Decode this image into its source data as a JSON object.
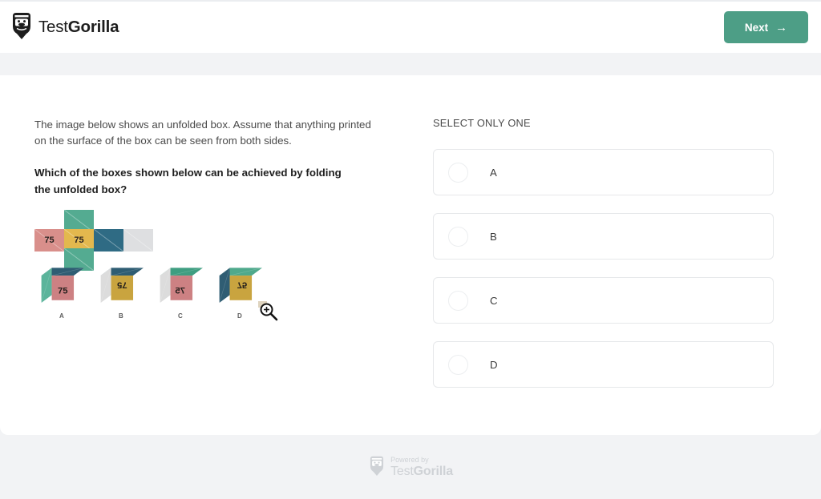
{
  "header": {
    "brand_name_light": "Test",
    "brand_name_bold": "Gorilla",
    "logo_icon": "gorilla-head-icon",
    "next_label": "Next",
    "next_arrow": "→",
    "next_color": "#4d9e86"
  },
  "question": {
    "intro": "The image below shows an unfolded box. Assume that anything printed on the surface of the box can be seen from both sides.",
    "prompt": "Which of the boxes shown below can be achieved by folding the unfolded box?"
  },
  "unfolded_net": {
    "description": "cross-shaped unfolded box net",
    "cells": [
      {
        "name": "top-flap",
        "col": 1,
        "row": 0,
        "fill": "#54ab91",
        "text": ""
      },
      {
        "name": "left-face",
        "col": 0,
        "row": 1,
        "fill": "#d98f8b",
        "text": "75"
      },
      {
        "name": "front-face",
        "col": 1,
        "row": 1,
        "fill": "#e3b84e",
        "text": "75"
      },
      {
        "name": "right-face",
        "col": 2,
        "row": 1,
        "fill": "#2f6b84",
        "text": ""
      },
      {
        "name": "far-face",
        "col": 3,
        "row": 1,
        "fill": "#dedfe1",
        "text": ""
      },
      {
        "name": "bottom-flap",
        "col": 1,
        "row": 2,
        "fill": "#54ab91",
        "text": ""
      }
    ]
  },
  "cubes": [
    {
      "label": "A",
      "front_fill": "#cd8183",
      "front_text": "75",
      "front_transform": "none",
      "top_fill": "#2f5d73",
      "side_fill": "#5bb49b"
    },
    {
      "label": "B",
      "front_fill": "#c9a43f",
      "front_text": "75",
      "front_transform": "rotate-180",
      "top_fill": "#2f5d73",
      "side_fill": "#dcdcdc"
    },
    {
      "label": "C",
      "front_fill": "#cd8183",
      "front_text": "75",
      "front_transform": "mirror",
      "top_fill": "#3f9e81",
      "side_fill": "#dcdcdc"
    },
    {
      "label": "D",
      "front_fill": "#c9a43f",
      "front_text": "75",
      "front_transform": "mirror-180",
      "top_fill": "#4fa98c",
      "side_fill": "#2f5d73"
    }
  ],
  "cursor": {
    "icon": "zoom-in-magnifier-icon"
  },
  "answers": {
    "select_label": "SELECT ONLY ONE",
    "options": [
      {
        "label": "A",
        "selected": false
      },
      {
        "label": "B",
        "selected": false
      },
      {
        "label": "C",
        "selected": false
      },
      {
        "label": "D",
        "selected": false
      }
    ]
  },
  "footer": {
    "powered_by": "Powered by",
    "brand_light": "Test",
    "brand_bold": "Gorilla",
    "logo_icon": "gorilla-head-icon"
  }
}
